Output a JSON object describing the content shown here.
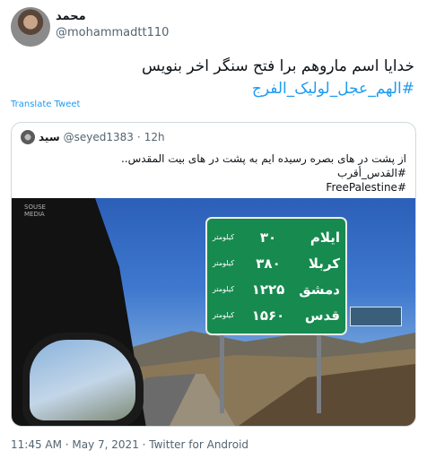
{
  "tweet": {
    "author_name": "محمد",
    "author_handle": "@mohammadtt110",
    "text_line1": "خدایا اسم ماروهم برا فتح سنگر اخر بنویس",
    "hashtag": "#الهم_عجل_لولیک_الفرج",
    "translate_label": "Translate Tweet",
    "footer": "11:45 AM · May 7, 2021 · Twitter for Android"
  },
  "quote": {
    "name": "سید",
    "handle": "@seyed1383",
    "dot": "·",
    "time": "12h",
    "line1": "از پشت در های بصره رسیده ایم به پشت در های بیت المقدس..",
    "line2": "#القدس_أقرب",
    "line3": "#FreePalestine"
  },
  "photo": {
    "watermark_line1": "SOUSE",
    "watermark_line2": "MEDIA",
    "sign_rows": [
      {
        "dest": "ایلام",
        "km": "۳۰",
        "unit": "کیلومتر"
      },
      {
        "dest": "کربلا",
        "km": "۳۸۰",
        "unit": "کیلومتر"
      },
      {
        "dest": "دمشق",
        "km": "۱۲۲۵",
        "unit": "کیلومتر"
      },
      {
        "dest": "قدس",
        "km": "۱۵۶۰",
        "unit": "کیلومتر"
      }
    ]
  },
  "colors": {
    "link": "#1d9bf0",
    "secondary_text": "#536471",
    "sign_green": "#178a4f"
  }
}
